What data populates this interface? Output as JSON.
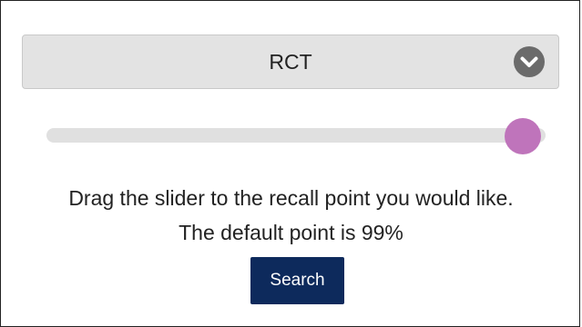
{
  "dropdown": {
    "selected_value": "RCT",
    "icon": "chevron-down-circle-icon"
  },
  "slider": {
    "value_percent": 99
  },
  "instructions": {
    "line1": "Drag the slider to the recall point you would like.",
    "line2": "The default point is 99%"
  },
  "search_button": {
    "label": "Search"
  },
  "colors": {
    "thumb": "#bf74bb",
    "button": "#0d2a5c",
    "dropdown_bg": "#e3e3e3",
    "track": "#e0e0e0"
  }
}
